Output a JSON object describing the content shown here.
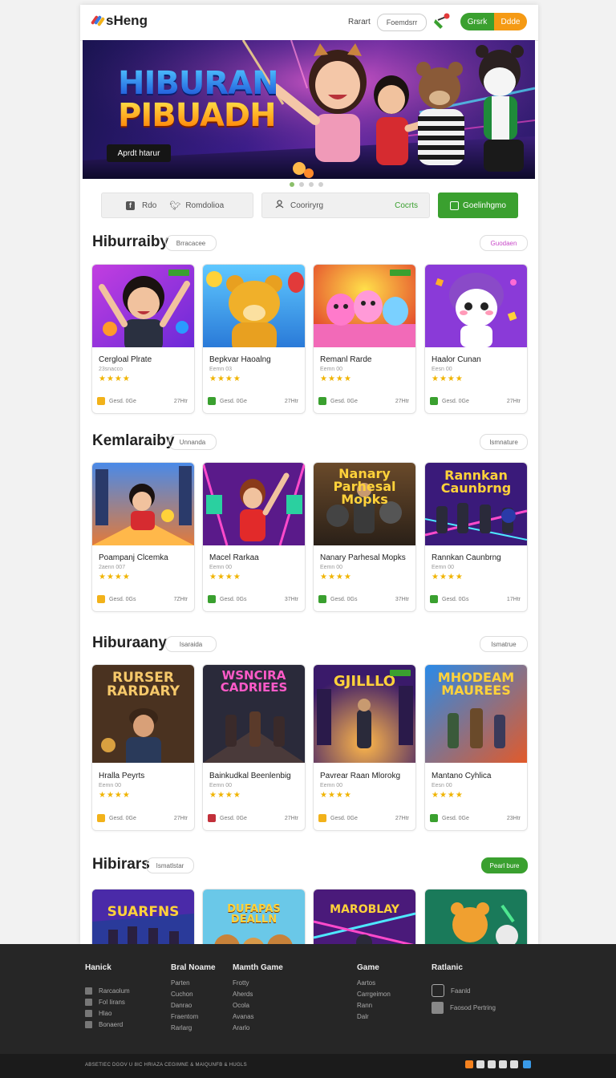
{
  "header": {
    "logo": "sHeng",
    "link": "Rarart",
    "pill": "Foemdsrr",
    "btn_green": "Grsrk",
    "btn_orange": "Ddde"
  },
  "banner": {
    "title_1": "HIBURAN",
    "title_2": "PIBUADH",
    "button": "Aprdt htarur"
  },
  "filters": {
    "item1": "Rdo",
    "item2": "Romdolioa",
    "item3": "Cooriryrg",
    "item4": "Cocrts",
    "item5": "Goelinhgmo"
  },
  "sections": [
    {
      "title": "Hiburraiby",
      "pill": "Brracacee",
      "right": "Guodaen",
      "cards": [
        {
          "title": "Cergloal Plrate",
          "sub": "23snacco",
          "rating": 4,
          "meta": "Gesd. 0Ge",
          "count": "27Htr"
        },
        {
          "title": "Bepkvar Haoalng",
          "sub": "Eemn 03",
          "rating": 4,
          "meta": "Gesd. 0Ge",
          "count": "27Htr"
        },
        {
          "title": "Remanl Rarde",
          "sub": "Eemn 00",
          "rating": 4,
          "meta": "Gesd. 0Ge",
          "count": "27Htr"
        },
        {
          "title": "Haalor Cunan",
          "sub": "Eesn 00",
          "rating": 4,
          "meta": "Gesd. 0Ge",
          "count": "27Htr"
        }
      ]
    },
    {
      "title": "Kemlaraiby",
      "pill": "Unnanda",
      "right": "Ismnature",
      "cards": [
        {
          "title": "Poampanj Clcemka",
          "sub": "2aenn 007",
          "rating": 4,
          "meta": "Gesd. 0Gs",
          "count": "7ZHtr"
        },
        {
          "title": "Macel Rarkaa",
          "sub": "Eemn 00",
          "rating": 4,
          "meta": "Gesd. 0Gs",
          "count": "37Htr"
        },
        {
          "title": "Nanary Parhesal Mopks",
          "sub": "Eemn 00",
          "rating": 4,
          "meta": "Gesd. 0Gs",
          "count": "37Htr"
        },
        {
          "title": "Rannkan Caunbrng",
          "sub": "Eemn 00",
          "rating": 4,
          "meta": "Gesd. 0Gs",
          "count": "17Htr"
        }
      ]
    },
    {
      "title": "Hiburaany",
      "pill": "Isaraida",
      "right": "Ismatrue",
      "cards": [
        {
          "title": "Hralla Peyrts",
          "sub": "Eemn 00",
          "rating": 4,
          "meta": "Gesd. 0Ge",
          "count": "27Htr"
        },
        {
          "title": "Bainkudkal Beenlenbig",
          "sub": "Eemn 00",
          "rating": 4,
          "meta": "Gesd. 0Ge",
          "count": "27Htr"
        },
        {
          "title": "Pavrear Raan Mlorokg",
          "sub": "Eemn 00",
          "rating": 4,
          "meta": "Gesd. 0Ge",
          "count": "27Htr"
        },
        {
          "title": "Mantano Cyhlica",
          "sub": "Eesn 00",
          "rating": 4,
          "meta": "Gesd. 0Ge",
          "count": "23Htr"
        }
      ]
    },
    {
      "title": "Hibirars",
      "pill": "Ismatlstar",
      "right": "Pearl bure",
      "cards": [
        {
          "game_text": "SUARFNS"
        },
        {
          "game_text": "DUFAPAS DEALLN"
        },
        {
          "game_text": "MAROBLAY"
        },
        {
          "game_text": ""
        }
      ]
    }
  ],
  "game_texts": [
    "RURSER RARDARY",
    "WSNCIRA CADRIEES",
    "GJILLLO",
    "MHODEAM MAUREES"
  ],
  "footer": {
    "cols": [
      {
        "title": "Hanick",
        "links": [
          "Rarcaolum",
          "Fol Iirans",
          "Hlao",
          "Bonaerd"
        ]
      },
      {
        "title": "Bral Noame",
        "links": [
          "Parten",
          "Cuchon",
          "Danrao",
          "Fraentom",
          "Rarlarg"
        ]
      },
      {
        "title": "Mamth Game",
        "links": [
          "Frotty",
          "Aherds",
          "Ocola",
          "Avanas",
          "Ararlo"
        ]
      },
      {
        "title": "Game",
        "links": [
          "Aartos",
          "Carrgeimon",
          "Rann",
          "Dalr"
        ]
      },
      {
        "title": "Ratlanic",
        "links": [
          "Faanld",
          "Faosod Pertring"
        ]
      }
    ],
    "copyright": "ABSETIEC DGOV U 8IC HRIAZA CEGIMNE & MAIQUNFB & HUGLS"
  },
  "colors": {
    "green": "#3aa02f",
    "orange": "#f59a14",
    "star": "#f0b400",
    "footer": "#262626"
  }
}
